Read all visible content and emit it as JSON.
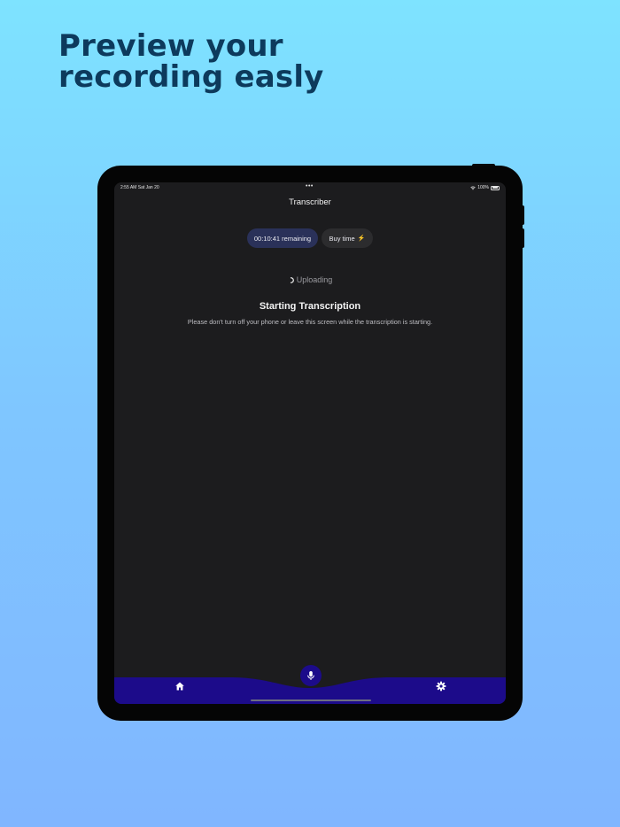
{
  "marketing": {
    "headline_line1": "Preview your",
    "headline_line2": "recording easly"
  },
  "device": {
    "status_bar": {
      "time_date": "2:55 AM   Sat Jan 20",
      "center_dots": "•••",
      "battery": "100%"
    }
  },
  "app": {
    "title": "Transcriber",
    "remaining_pill": "00:10:41 remaining",
    "buy_time_button": "Buy time",
    "upload_status": "Uploading",
    "status_title": "Starting Transcription",
    "status_message": "Please don't turn off your phone or leave this screen while the transcription is starting."
  },
  "tabbar": {
    "items": [
      {
        "name": "home",
        "icon": "home-icon"
      },
      {
        "name": "record",
        "icon": "microphone-icon"
      },
      {
        "name": "settings",
        "icon": "gear-icon"
      }
    ]
  },
  "colors": {
    "background_top": "#7ee3ff",
    "background_bottom": "#80b6ff",
    "headline": "#0d3a5c",
    "screen_bg": "#1c1c1e",
    "tabbar": "#1c0b8a",
    "remaining_pill": "#2a3159",
    "bolt": "#f5c518"
  }
}
